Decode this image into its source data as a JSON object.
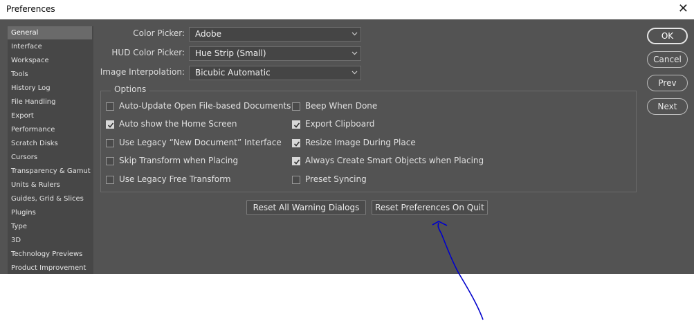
{
  "window": {
    "title": "Preferences",
    "close_glyph": "✕"
  },
  "sidebar": {
    "items": [
      {
        "label": "General",
        "selected": true
      },
      {
        "label": "Interface"
      },
      {
        "label": "Workspace"
      },
      {
        "label": "Tools"
      },
      {
        "label": "History Log"
      },
      {
        "label": "File Handling"
      },
      {
        "label": "Export"
      },
      {
        "label": "Performance"
      },
      {
        "label": "Scratch Disks"
      },
      {
        "label": "Cursors"
      },
      {
        "label": "Transparency & Gamut"
      },
      {
        "label": "Units & Rulers"
      },
      {
        "label": "Guides, Grid & Slices"
      },
      {
        "label": "Plugins"
      },
      {
        "label": "Type"
      },
      {
        "label": "3D"
      },
      {
        "label": "Technology Previews"
      },
      {
        "label": "Product Improvement"
      }
    ]
  },
  "general": {
    "color_picker": {
      "label": "Color Picker:",
      "value": "Adobe"
    },
    "hud_color_picker": {
      "label": "HUD Color Picker:",
      "value": "Hue Strip (Small)"
    },
    "image_interpolation": {
      "label": "Image Interpolation:",
      "value": "Bicubic Automatic"
    }
  },
  "options": {
    "legend": "Options",
    "left": [
      {
        "label": "Auto-Update Open File-based Documents",
        "checked": false
      },
      {
        "label": "Auto show the Home Screen",
        "checked": true
      },
      {
        "label": "Use Legacy “New Document” Interface",
        "checked": false
      },
      {
        "label": "Skip Transform when Placing",
        "checked": false
      },
      {
        "label": "Use Legacy Free Transform",
        "checked": false
      }
    ],
    "right": [
      {
        "label": "Beep When Done",
        "checked": false
      },
      {
        "label": "Export Clipboard",
        "checked": true
      },
      {
        "label": "Resize Image During Place",
        "checked": true
      },
      {
        "label": "Always Create Smart Objects when Placing",
        "checked": true
      },
      {
        "label": "Preset Syncing",
        "checked": false
      }
    ]
  },
  "actions": {
    "reset_warnings": "Reset All Warning Dialogs",
    "reset_prefs": "Reset Preferences On Quit"
  },
  "buttons": {
    "ok": "OK",
    "cancel": "Cancel",
    "prev": "Prev",
    "next": "Next"
  },
  "colors": {
    "panel": "#535353",
    "sidebar": "#474747",
    "annotation": "#0000cc"
  }
}
